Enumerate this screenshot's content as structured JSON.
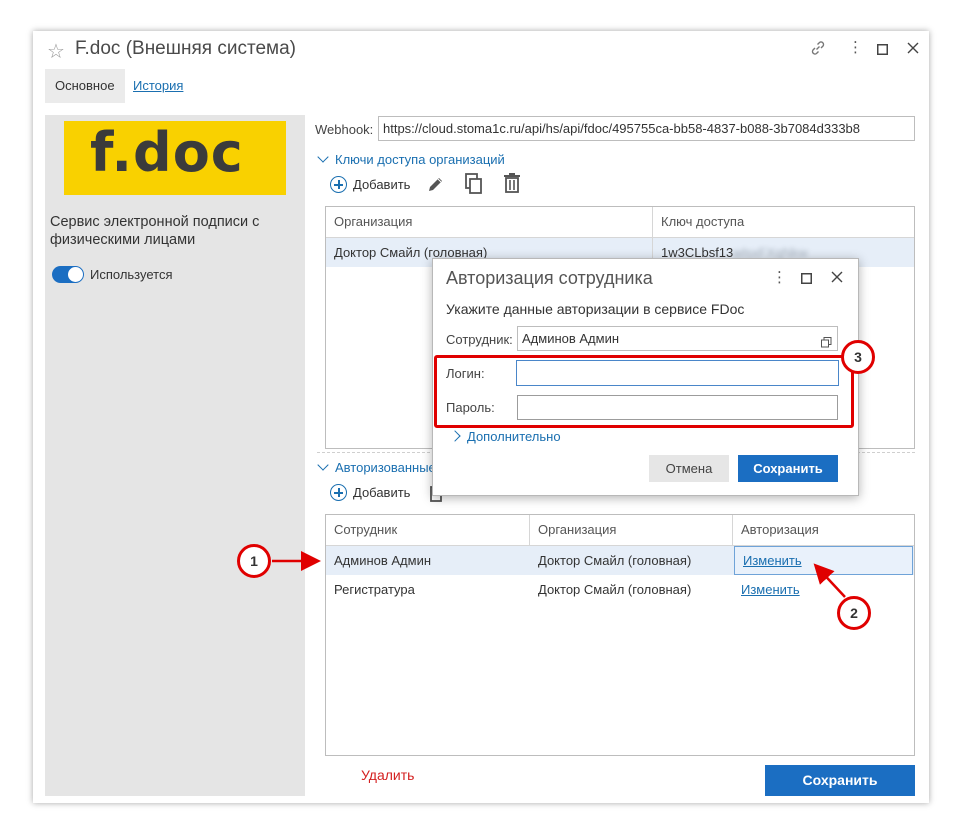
{
  "window": {
    "title": "F.doc (Внешняя система)",
    "tabs": [
      {
        "label": "Основное",
        "active": true
      },
      {
        "label": "История",
        "active": false
      }
    ]
  },
  "left_panel": {
    "logo_text": "f.doc",
    "service_description": "Сервис электронной подписи с физическими лицами",
    "toggle": {
      "label": "Используется",
      "on": true
    }
  },
  "form": {
    "webhook_label": "Webhook:",
    "webhook_value": "https://cloud.stoma1c.ru/api/hs/api/fdoc/495755ca-bb58-4837-b088-3b7084d333b8",
    "keys_section": {
      "title": "Ключи доступа организаций",
      "add_label": "Добавить",
      "columns": [
        "Организация",
        "Ключ доступа"
      ],
      "rows": [
        {
          "org": "Доктор Смайл (головная)",
          "key": "1w3CLbsf13",
          "key_hidden": "wlsxFXqNkw"
        }
      ]
    },
    "auth_section": {
      "title": "Авторизованные сотрудники",
      "add_label": "Добавить",
      "columns": [
        "Сотрудник",
        "Организация",
        "Авторизация"
      ],
      "rows": [
        {
          "employee": "Админов Админ",
          "org": "Доктор Смайл (головная)",
          "auth": "Изменить",
          "selected": true
        },
        {
          "employee": "Регистратура",
          "org": "Доктор Смайл (головная)",
          "auth": "Изменить",
          "selected": false
        }
      ]
    },
    "delete_label": "Удалить",
    "save_label": "Сохранить"
  },
  "dialog": {
    "title": "Авторизация сотрудника",
    "subtitle": "Укажите данные авторизации в сервисе FDoc",
    "employee_label": "Сотрудник:",
    "employee_value": "Админов Админ",
    "login_label": "Логин:",
    "login_value": "",
    "password_label": "Пароль:",
    "password_value": "",
    "advanced_label": "Дополнительно",
    "cancel_label": "Отмена",
    "save_label": "Сохранить"
  },
  "annotations": {
    "callout_1": "1",
    "callout_2": "2",
    "callout_3": "3"
  },
  "colors": {
    "accent": "#1b6ec2",
    "link": "#1a6fb0",
    "logo_bg": "#f9d100",
    "danger": "#d42020",
    "annotation_red": "#e00000"
  }
}
